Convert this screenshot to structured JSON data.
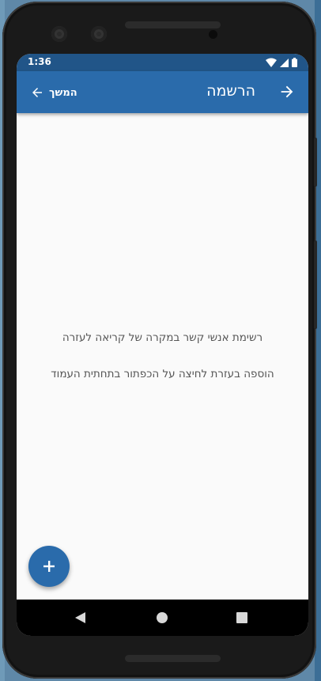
{
  "status_bar": {
    "time": "1:36",
    "icons": [
      "wifi-icon",
      "cell-signal-icon",
      "battery-icon"
    ]
  },
  "app_bar": {
    "title": "הרשמה",
    "continue_label": "המשך",
    "background_color": "#2a6bab"
  },
  "content": {
    "line1": "רשימת אנשי קשר במקרה של קריאה לעזרה",
    "line2": "הוספה בעזרת לחיצה על הכפתור בתחתית העמוד"
  },
  "fab": {
    "icon": "plus-icon",
    "color": "#2a6bab"
  },
  "nav_bar": {
    "buttons": [
      "back-icon",
      "home-icon",
      "recents-icon"
    ]
  }
}
